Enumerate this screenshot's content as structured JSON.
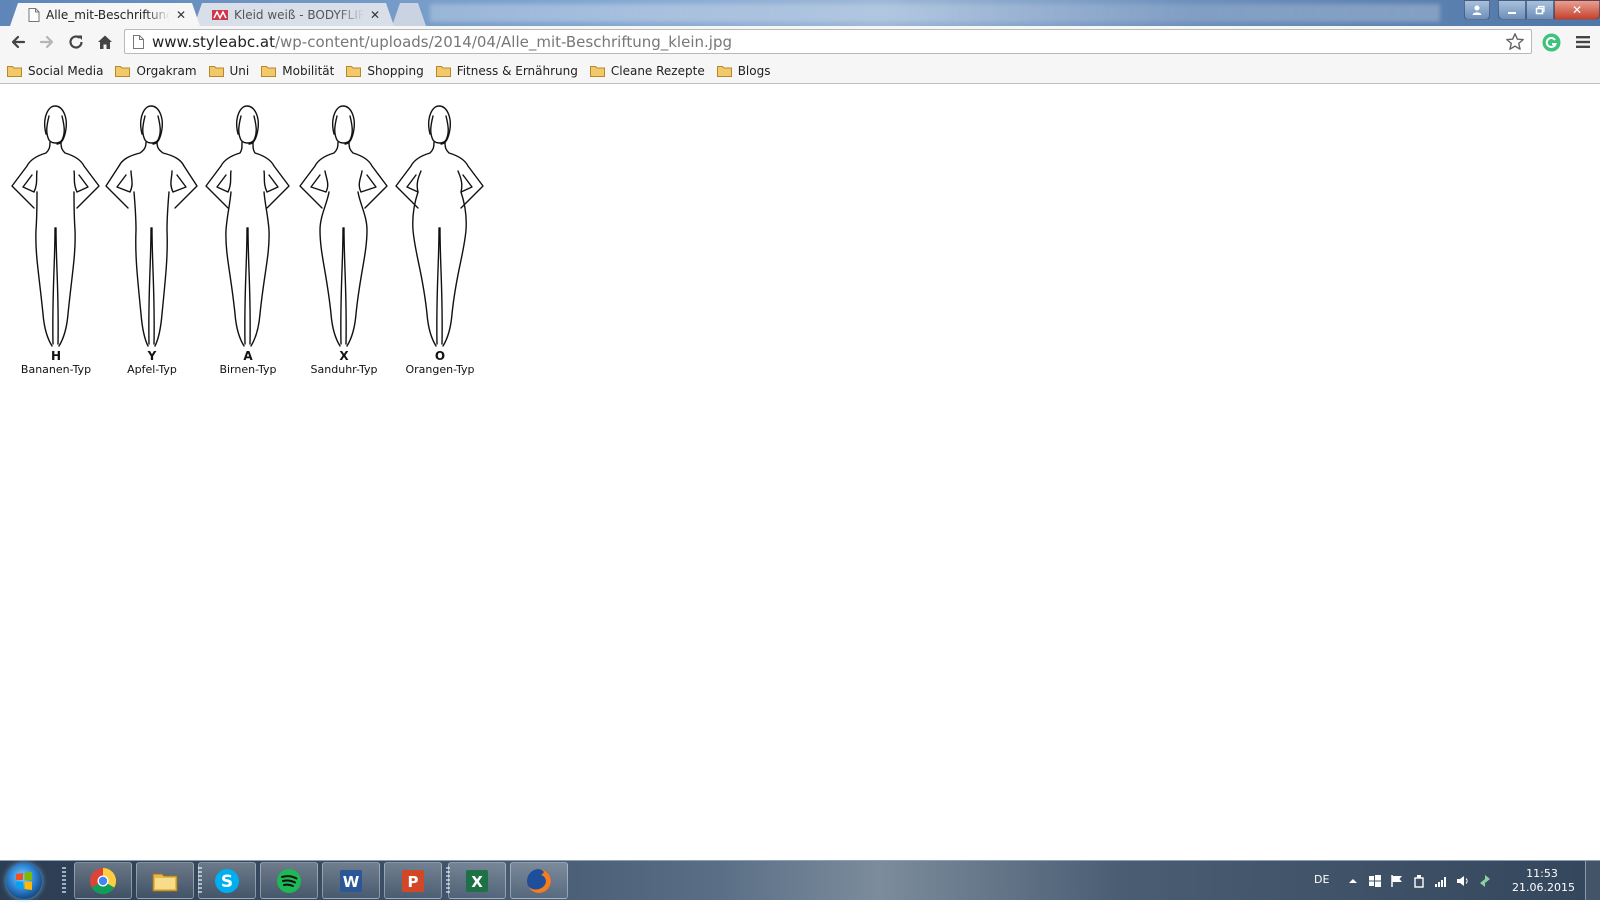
{
  "browser": {
    "tabs": [
      {
        "label": "Alle_mit-Beschriftung_klein.jpg",
        "favicon": "page-icon",
        "active": true
      },
      {
        "label": "Kleid weiß - BODYFLIRT bei",
        "favicon": "bodyflirt-logo-icon",
        "active": false
      }
    ],
    "address_bar": {
      "url_host": "www.styleabc.at",
      "url_path": "/wp-content/uploads/2014/04/Alle_mit-Beschriftung_klein.jpg"
    },
    "bookmarks": [
      {
        "label": "Social Media",
        "icon": "folder-icon"
      },
      {
        "label": "Orgakram",
        "icon": "folder-icon"
      },
      {
        "label": "Uni",
        "icon": "folder-icon"
      },
      {
        "label": "Mobilität",
        "icon": "folder-icon"
      },
      {
        "label": "Shopping",
        "icon": "folder-icon"
      },
      {
        "label": "Fitness & Ernährung",
        "icon": "folder-icon"
      },
      {
        "label": "Cleane Rezepte",
        "icon": "folder-icon"
      },
      {
        "label": "Blogs",
        "icon": "folder-icon"
      }
    ]
  },
  "image": {
    "figures": [
      {
        "letter": "H",
        "name": "Bananen-Typ"
      },
      {
        "letter": "Y",
        "name": "Apfel-Typ"
      },
      {
        "letter": "A",
        "name": "Birnen-Typ"
      },
      {
        "letter": "X",
        "name": "Sanduhr-Typ"
      },
      {
        "letter": "O",
        "name": "Orangen-Typ"
      }
    ]
  },
  "taskbar": {
    "apps": [
      "chrome-icon",
      "file-explorer-icon",
      "skype-icon",
      "spotify-icon",
      "word-icon",
      "powerpoint-icon",
      "excel-icon",
      "firefox-icon"
    ],
    "language": "DE",
    "time": "11:53",
    "date": "21.06.2015"
  },
  "colors": {
    "chrome_toolbar": "#f6f6f6",
    "taskbar": "#3b4f66"
  }
}
